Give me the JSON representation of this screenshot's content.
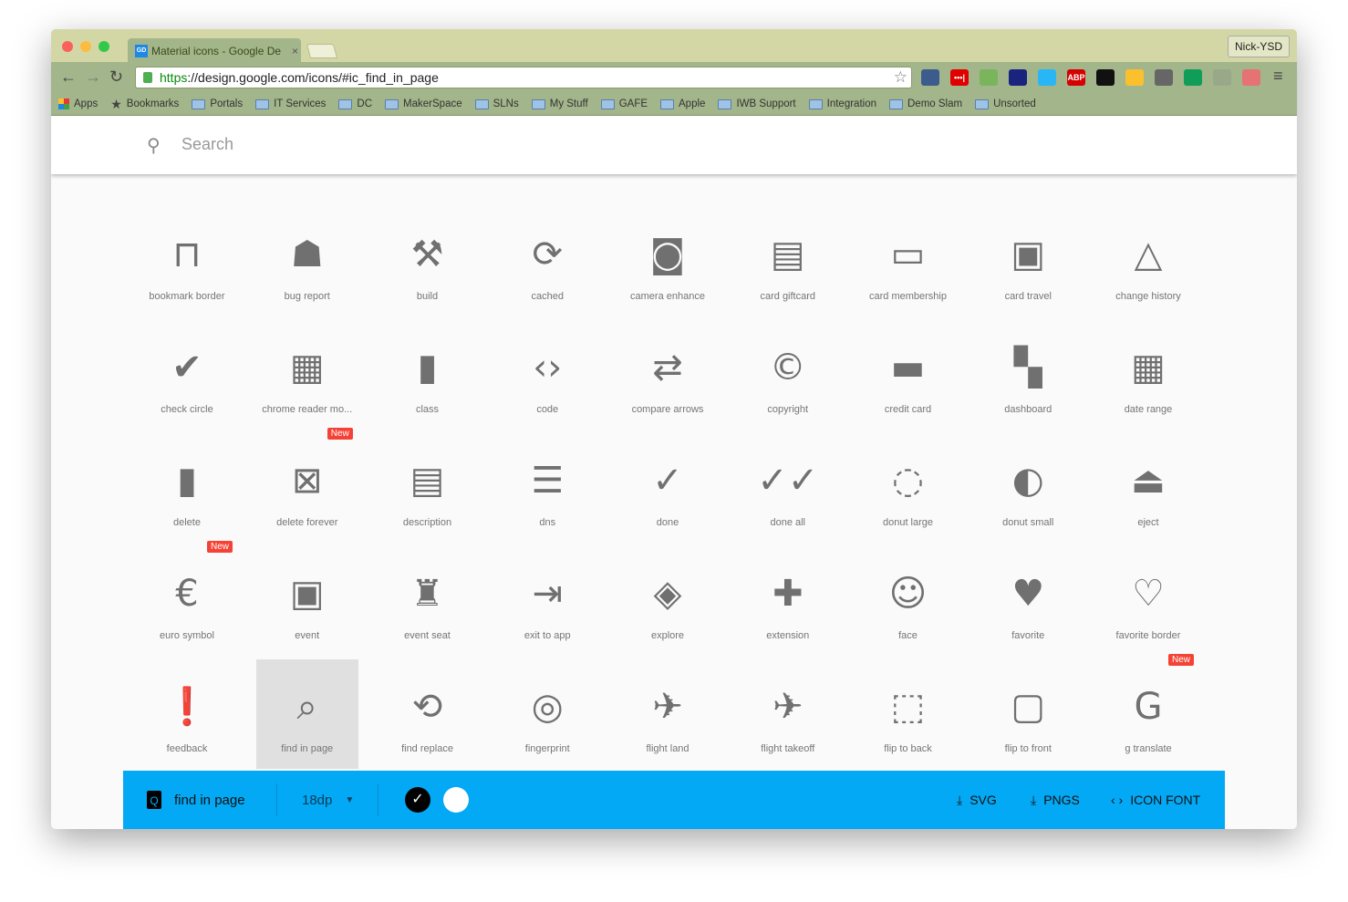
{
  "browser": {
    "tab_title": "Material icons - Google De",
    "tab_favicon": "GD",
    "profile": "Nick-YSD",
    "url_scheme": "https",
    "url_rest": "://design.google.com/icons/#ic_find_in_page",
    "extensions": [
      {
        "name": "ext-1",
        "color": "#3b5c8c",
        "text": ""
      },
      {
        "name": "lastpass",
        "color": "#e00000",
        "text": "•••|"
      },
      {
        "name": "ext-3",
        "color": "#7ab55c",
        "text": ""
      },
      {
        "name": "cloud",
        "color": "#1a237e",
        "text": ""
      },
      {
        "name": "pin",
        "color": "#29b6f6",
        "text": ""
      },
      {
        "name": "adblock-plus",
        "color": "#d50000",
        "text": "ABP"
      },
      {
        "name": "qr-code",
        "color": "#111111",
        "text": ""
      },
      {
        "name": "keep",
        "color": "#fbc02d",
        "text": ""
      },
      {
        "name": "bulb",
        "color": "#666666",
        "text": ""
      },
      {
        "name": "classroom",
        "color": "#0f9d58",
        "text": ""
      },
      {
        "name": "cast",
        "color": "#9aa88a",
        "text": ""
      },
      {
        "name": "ext-12",
        "color": "#e57373",
        "text": ""
      }
    ],
    "bookmarks": [
      {
        "label": "Apps",
        "icon": "apps-icon"
      },
      {
        "label": "Bookmarks",
        "icon": "star-icon"
      },
      {
        "label": "Portals",
        "icon": "folder-icon"
      },
      {
        "label": "IT Services",
        "icon": "folder-icon"
      },
      {
        "label": "DC",
        "icon": "folder-icon"
      },
      {
        "label": "MakerSpace",
        "icon": "folder-icon"
      },
      {
        "label": "SLNs",
        "icon": "folder-icon"
      },
      {
        "label": "My Stuff",
        "icon": "folder-icon"
      },
      {
        "label": "GAFE",
        "icon": "folder-icon"
      },
      {
        "label": "Apple",
        "icon": "folder-icon"
      },
      {
        "label": "IWB Support",
        "icon": "folder-icon"
      },
      {
        "label": "Integration",
        "icon": "folder-icon"
      },
      {
        "label": "Demo Slam",
        "icon": "folder-icon"
      },
      {
        "label": "Unsorted",
        "icon": "folder-icon"
      }
    ]
  },
  "search": {
    "placeholder": "Search"
  },
  "icons": [
    {
      "label": "bookmark border",
      "glyph": "⊓"
    },
    {
      "label": "bug report",
      "glyph": "☗"
    },
    {
      "label": "build",
      "glyph": "⚒"
    },
    {
      "label": "cached",
      "glyph": "⟳"
    },
    {
      "label": "camera enhance",
      "glyph": "◙"
    },
    {
      "label": "card giftcard",
      "glyph": "▤"
    },
    {
      "label": "card membership",
      "glyph": "▭"
    },
    {
      "label": "card travel",
      "glyph": "▣"
    },
    {
      "label": "change history",
      "glyph": "△"
    },
    {
      "label": "check circle",
      "glyph": "✔"
    },
    {
      "label": "chrome reader mo...",
      "glyph": "▦"
    },
    {
      "label": "class",
      "glyph": "▮"
    },
    {
      "label": "code",
      "glyph": "‹›"
    },
    {
      "label": "compare arrows",
      "glyph": "⇄"
    },
    {
      "label": "copyright",
      "glyph": "©"
    },
    {
      "label": "credit card",
      "glyph": "▬"
    },
    {
      "label": "dashboard",
      "glyph": "▚"
    },
    {
      "label": "date range",
      "glyph": "▦"
    },
    {
      "label": "delete",
      "glyph": "▮"
    },
    {
      "label": "delete forever",
      "glyph": "⊠",
      "badge": "New"
    },
    {
      "label": "description",
      "glyph": "▤"
    },
    {
      "label": "dns",
      "glyph": "☰"
    },
    {
      "label": "done",
      "glyph": "✓"
    },
    {
      "label": "done all",
      "glyph": "✓✓"
    },
    {
      "label": "donut large",
      "glyph": "◌"
    },
    {
      "label": "donut small",
      "glyph": "◐"
    },
    {
      "label": "eject",
      "glyph": "⏏"
    },
    {
      "label": "euro symbol",
      "glyph": "€",
      "badge": "New"
    },
    {
      "label": "event",
      "glyph": "▣"
    },
    {
      "label": "event seat",
      "glyph": "♜"
    },
    {
      "label": "exit to app",
      "glyph": "⇥"
    },
    {
      "label": "explore",
      "glyph": "◈"
    },
    {
      "label": "extension",
      "glyph": "✚"
    },
    {
      "label": "face",
      "glyph": "☺"
    },
    {
      "label": "favorite",
      "glyph": "♥"
    },
    {
      "label": "favorite border",
      "glyph": "♡"
    },
    {
      "label": "feedback",
      "glyph": "❗"
    },
    {
      "label": "find in page",
      "glyph": "⌕",
      "selected": true
    },
    {
      "label": "find replace",
      "glyph": "⟲"
    },
    {
      "label": "fingerprint",
      "glyph": "◎"
    },
    {
      "label": "flight land",
      "glyph": "✈"
    },
    {
      "label": "flight takeoff",
      "glyph": "✈"
    },
    {
      "label": "flip to back",
      "glyph": "⬚"
    },
    {
      "label": "flip to front",
      "glyph": "▢"
    },
    {
      "label": "g translate",
      "glyph": "G",
      "badge": "New"
    }
  ],
  "bottom_bar": {
    "selected_name": "find in page",
    "size": "18dp",
    "colors": [
      "#000000",
      "#ffffff"
    ],
    "svg": "SVG",
    "pngs": "PNGS",
    "icon_font": "ICON FONT",
    "bg": "#03a9f4"
  }
}
